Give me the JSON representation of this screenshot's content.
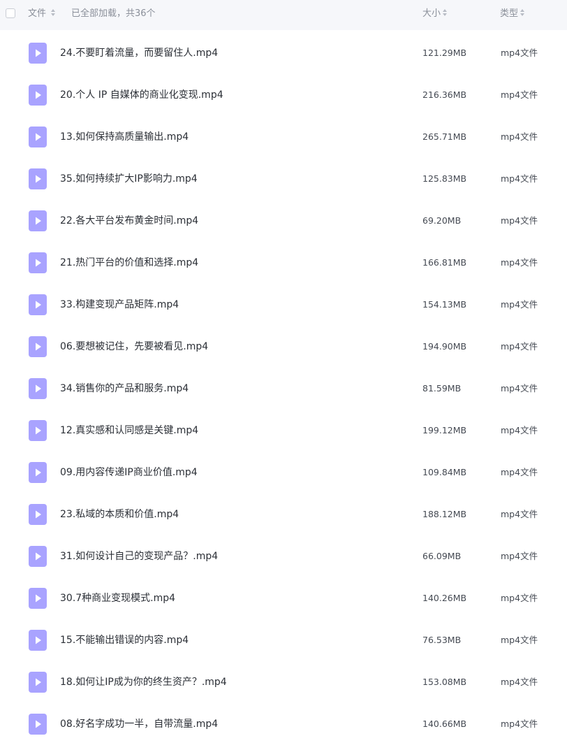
{
  "header": {
    "file_col": "文件",
    "loaded_status": "已全部加载，共36个",
    "size_col": "大小",
    "type_col": "类型"
  },
  "colors": {
    "file_icon": "#a9a3ff",
    "header_bg": "#f6f7fa"
  },
  "files": [
    {
      "name": "24.不要盯着流量，而要留住人.mp4",
      "size": "121.29MB",
      "type": "mp4文件"
    },
    {
      "name": "20.个人 IP 自媒体的商业化变现.mp4",
      "size": "216.36MB",
      "type": "mp4文件"
    },
    {
      "name": "13.如何保持高质量输出.mp4",
      "size": "265.71MB",
      "type": "mp4文件"
    },
    {
      "name": "35.如何持续扩大IP影响力.mp4",
      "size": "125.83MB",
      "type": "mp4文件"
    },
    {
      "name": "22.各大平台发布黄金时间.mp4",
      "size": "69.20MB",
      "type": "mp4文件"
    },
    {
      "name": "21.热门平台的价值和选择.mp4",
      "size": "166.81MB",
      "type": "mp4文件"
    },
    {
      "name": "33.构建变现产品矩阵.mp4",
      "size": "154.13MB",
      "type": "mp4文件"
    },
    {
      "name": "06.要想被记住，先要被看见.mp4",
      "size": "194.90MB",
      "type": "mp4文件"
    },
    {
      "name": "34.销售你的产品和服务.mp4",
      "size": "81.59MB",
      "type": "mp4文件"
    },
    {
      "name": "12.真实感和认同感是关键.mp4",
      "size": "199.12MB",
      "type": "mp4文件"
    },
    {
      "name": "09.用内容传递IP商业价值.mp4",
      "size": "109.84MB",
      "type": "mp4文件"
    },
    {
      "name": "23.私域的本质和价值.mp4",
      "size": "188.12MB",
      "type": "mp4文件"
    },
    {
      "name": "31.如何设计自己的变现产品？.mp4",
      "size": "66.09MB",
      "type": "mp4文件"
    },
    {
      "name": "30.7种商业变现模式.mp4",
      "size": "140.26MB",
      "type": "mp4文件"
    },
    {
      "name": "15.不能输出错误的内容.mp4",
      "size": "76.53MB",
      "type": "mp4文件"
    },
    {
      "name": "18.如何让IP成为你的终生资产？.mp4",
      "size": "153.08MB",
      "type": "mp4文件"
    },
    {
      "name": "08.好名字成功一半，自带流量.mp4",
      "size": "140.66MB",
      "type": "mp4文件"
    }
  ]
}
